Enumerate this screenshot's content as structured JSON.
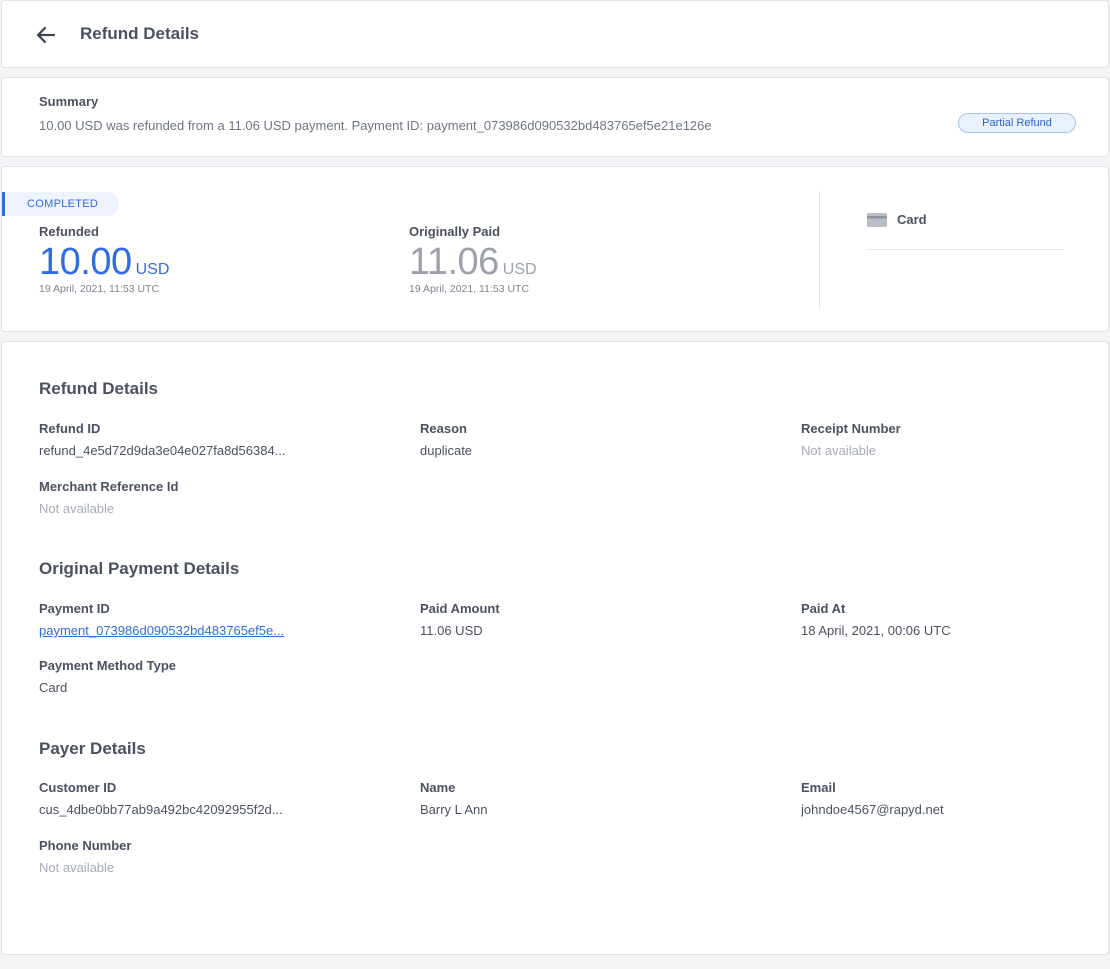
{
  "header": {
    "title": "Refund Details"
  },
  "summary": {
    "label": "Summary",
    "text": "10.00 USD was refunded from a 11.06 USD payment. Payment ID: payment_073986d090532bd483765ef5e21e126e",
    "badge": "Partial Refund"
  },
  "amounts": {
    "status": "COMPLETED",
    "refunded": {
      "label": "Refunded",
      "value": "10.00",
      "currency": "USD",
      "date": "19 April, 2021, 11:53 UTC"
    },
    "original": {
      "label": "Originally Paid",
      "value": "11.06",
      "currency": "USD",
      "date": "19 April, 2021, 11:53 UTC"
    },
    "method": "Card"
  },
  "refund_details": {
    "title": "Refund Details",
    "refund_id": {
      "label": "Refund ID",
      "value": "refund_4e5d72d9da3e04e027fa8d56384..."
    },
    "reason": {
      "label": "Reason",
      "value": "duplicate"
    },
    "receipt_number": {
      "label": "Receipt Number",
      "value": "Not available"
    },
    "merchant_reference": {
      "label": "Merchant Reference Id",
      "value": "Not available"
    }
  },
  "payment_details": {
    "title": "Original Payment Details",
    "payment_id": {
      "label": "Payment ID",
      "value": "payment_073986d090532bd483765ef5e..."
    },
    "paid_amount": {
      "label": "Paid Amount",
      "value": "11.06 USD"
    },
    "paid_at": {
      "label": "Paid At",
      "value": "18 April, 2021, 00:06 UTC"
    },
    "method_type": {
      "label": "Payment Method Type",
      "value": "Card"
    }
  },
  "payer_details": {
    "title": "Payer Details",
    "customer_id": {
      "label": "Customer ID",
      "value": "cus_4dbe0bb77ab9a492bc42092955f2d..."
    },
    "name": {
      "label": "Name",
      "value": "Barry L Ann"
    },
    "email": {
      "label": "Email",
      "value": "johndoe4567@rapyd.net"
    },
    "phone": {
      "label": "Phone Number",
      "value": "Not available"
    }
  },
  "colors": {
    "accent": "#2e6de0",
    "muted": "#a6abb5",
    "text": "#4a5160"
  }
}
